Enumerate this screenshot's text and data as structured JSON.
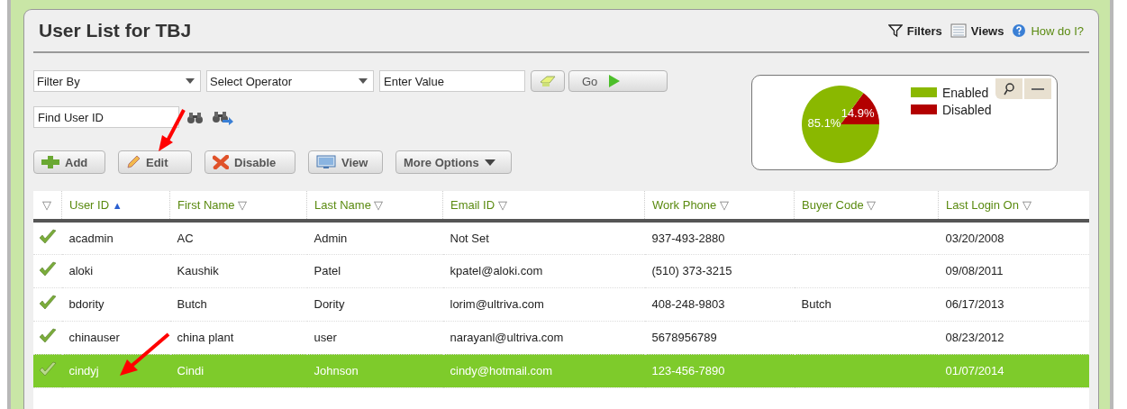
{
  "title": "User List for TBJ",
  "header_links": [
    {
      "kind": "filters",
      "label": "Filters"
    },
    {
      "kind": "views",
      "label": "Views"
    },
    {
      "kind": "help",
      "label": "How do I?"
    }
  ],
  "filter": {
    "field": {
      "value": "Filter By"
    },
    "operator": {
      "value": "Select Operator"
    },
    "value": {
      "placeholder": "Enter Value"
    },
    "go": "Go"
  },
  "find": {
    "placeholder": "Find User ID"
  },
  "actions": [
    {
      "kind": "add",
      "label": "Add"
    },
    {
      "kind": "edit",
      "label": "Edit"
    },
    {
      "kind": "disable",
      "label": "Disable"
    },
    {
      "kind": "view",
      "label": "View"
    },
    {
      "kind": "more",
      "label": "More Options"
    }
  ],
  "chart": {
    "chart_data": {
      "type": "pie",
      "categories": [
        "Enabled",
        "Disabled"
      ],
      "values": [
        85.1,
        14.9
      ],
      "colors": [
        "#8ab800",
        "#b30000"
      ],
      "value_labels": [
        "85.1%",
        "14.9%"
      ],
      "legend": "right"
    }
  },
  "table": {
    "columns": [
      {
        "sort": "▽"
      },
      {
        "label": "User ID",
        "sort": "▲"
      },
      {
        "label": "First Name",
        "sort": "▽"
      },
      {
        "label": "Last Name",
        "sort": "▽"
      },
      {
        "label": "Email ID",
        "sort": "▽"
      },
      {
        "label": "Work Phone",
        "sort": "▽"
      },
      {
        "label": "Buyer Code",
        "sort": "▽"
      },
      {
        "label": "Last Login On",
        "sort": "▽"
      }
    ],
    "rows": [
      {
        "selected": false,
        "cells": [
          "",
          "acadmin",
          "AC",
          "Admin",
          "Not Set",
          "937-493-2880",
          "",
          "03/20/2008"
        ]
      },
      {
        "selected": false,
        "cells": [
          "",
          "aloki",
          "Kaushik",
          "Patel",
          "kpatel@aloki.com",
          "(510) 373-3215",
          "",
          "09/08/2011"
        ]
      },
      {
        "selected": false,
        "cells": [
          "",
          "bdority",
          "Butch",
          "Dority",
          "lorim@ultriva.com",
          "408-248-9803",
          "Butch",
          "06/17/2013"
        ]
      },
      {
        "selected": false,
        "cells": [
          "",
          "chinauser",
          "china plant",
          "user",
          "narayanl@ultriva.com",
          "5678956789",
          "",
          "08/23/2012"
        ]
      },
      {
        "selected": true,
        "cells": [
          "",
          "cindyj",
          "Cindi",
          "Johnson",
          "cindy@hotmail.com",
          "123-456-7890",
          "",
          "01/07/2014"
        ]
      }
    ]
  }
}
